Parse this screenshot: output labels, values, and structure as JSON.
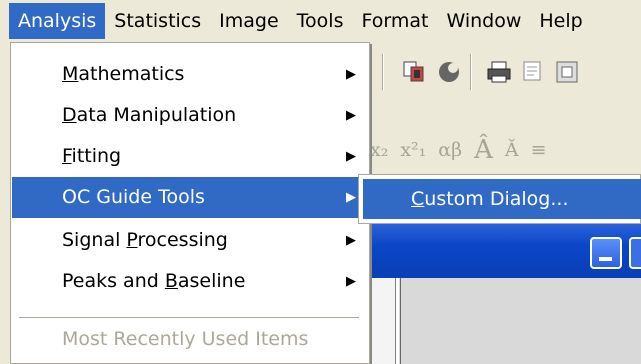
{
  "menubar": {
    "items": [
      "Analysis",
      "Statistics",
      "Image",
      "Tools",
      "Format",
      "Window",
      "Help"
    ]
  },
  "toolbar": {
    "format_glyphs": [
      "x₂",
      "x²₁",
      "αβ",
      "Â",
      "Ă",
      "≡"
    ]
  },
  "analysis_menu": {
    "items": [
      {
        "pre": "",
        "key": "M",
        "post": "athematics",
        "submenu": true
      },
      {
        "pre": "",
        "key": "D",
        "post": "ata Manipulation",
        "submenu": true
      },
      {
        "pre": "",
        "key": "F",
        "post": "itting",
        "submenu": true
      },
      {
        "pre": "OC Guide Tools",
        "key": "",
        "post": "",
        "submenu": true,
        "highlighted": true
      },
      {
        "pre": "Signal ",
        "key": "P",
        "post": "rocessing",
        "submenu": true
      },
      {
        "pre": "Peaks and ",
        "key": "B",
        "post": "aseline",
        "submenu": true
      },
      {
        "pre": "Most Recently Used Items",
        "key": "",
        "post": "",
        "submenu": false,
        "disabled": true
      }
    ],
    "arrow_glyph": "▶"
  },
  "submenu": {
    "item": {
      "pre": "",
      "key": "C",
      "post": "ustom Dialog..."
    }
  },
  "colors": {
    "highlight": "#316ac5",
    "menubar_bg": "#ece9d8",
    "disabled_text": "#aca899",
    "titlebar": "#0b46c8"
  }
}
